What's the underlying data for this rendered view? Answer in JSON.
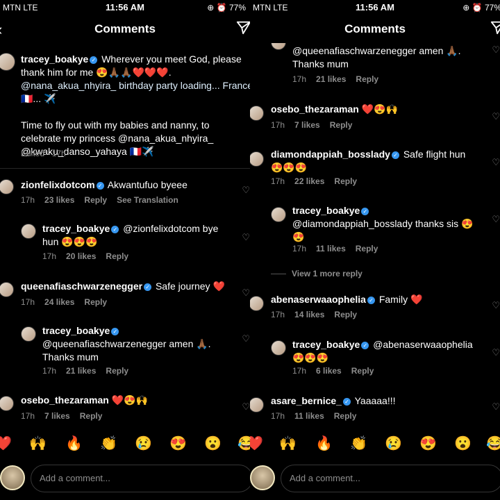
{
  "status": {
    "carrier": "MTN  LTE",
    "time": "11:56 AM",
    "battery": "77%"
  },
  "nav": {
    "title": "Comments"
  },
  "reactions": [
    "❤️",
    "🙌",
    "🔥",
    "👏",
    "😢",
    "😍",
    "😮",
    "😂"
  ],
  "composer": {
    "placeholder": "Add a comment..."
  },
  "left": {
    "caption": {
      "user": "tracey_boakye",
      "line1": "Wherever you meet God, please",
      "line2": "thank him for me 😍🙏🏾🙏🏾❤️❤️❤️.",
      "line3": "@nana_akua_nhyira_ birthday party loading... France",
      "line4": "🇫🇷... ✈️",
      "line5": "Time to fly out with my babies and nanny, to",
      "line6": "celebrate my princess @nana_akua_nhyira_",
      "line7": "@kwaku_danso_yahaya 🇫🇷✈️",
      "meta": "Edited · 17h"
    },
    "comments": [
      {
        "user": "zionfelixdotcom",
        "text": "Akwantufuo byeee",
        "time": "17h",
        "likes": "23 likes",
        "reply": "Reply",
        "extra": "See Translation"
      },
      {
        "user": "tracey_boakye",
        "text1": "@zionfelixdotcom bye",
        "text2": "hun 😍😍😍",
        "time": "17h",
        "likes": "20 likes",
        "reply": "Reply"
      },
      {
        "user": "queenafiaschwarzenegger",
        "text": "Safe journey ❤️",
        "time": "17h",
        "likes": "24 likes",
        "reply": "Reply"
      },
      {
        "user": "tracey_boakye",
        "text1": "@queenafiaschwarzenegger amen 🙏🏾.",
        "text2": "Thanks mum",
        "time": "17h",
        "likes": "21 likes",
        "reply": "Reply"
      },
      {
        "user": "osebo_thezaraman",
        "text": "❤️😍🙌",
        "time": "17h",
        "likes": "7 likes",
        "reply": "Reply"
      }
    ]
  },
  "right": {
    "comments": [
      {
        "text1": "@queenafiaschwarzenegger amen 🙏🏾.",
        "text2": "Thanks mum",
        "time": "17h",
        "likes": "21 likes",
        "reply": "Reply"
      },
      {
        "user": "osebo_thezaraman",
        "text": "❤️😍🙌",
        "time": "17h",
        "likes": "7 likes",
        "reply": "Reply"
      },
      {
        "user": "diamondappiah_bosslady",
        "text1": "Safe flight hun",
        "text2": "😍😍😍",
        "time": "17h",
        "likes": "22 likes",
        "reply": "Reply"
      },
      {
        "user": "tracey_boakye",
        "text1": "@diamondappiah_bosslady thanks sis 😍",
        "text2": "😍",
        "time": "17h",
        "likes": "11 likes",
        "reply": "Reply"
      },
      {
        "viewmore": "View 1 more reply"
      },
      {
        "user": "abenaserwaaophelia",
        "text": "Family ❤️",
        "time": "17h",
        "likes": "14 likes",
        "reply": "Reply"
      },
      {
        "user": "tracey_boakye",
        "text1": "@abenaserwaaophelia",
        "text2": "😍😍😍",
        "time": "17h",
        "likes": "6 likes",
        "reply": "Reply"
      },
      {
        "user": "asare_bernice_",
        "text": "Yaaaaa!!!",
        "time": "17h",
        "likes": "11 likes",
        "reply": "Reply"
      }
    ]
  }
}
